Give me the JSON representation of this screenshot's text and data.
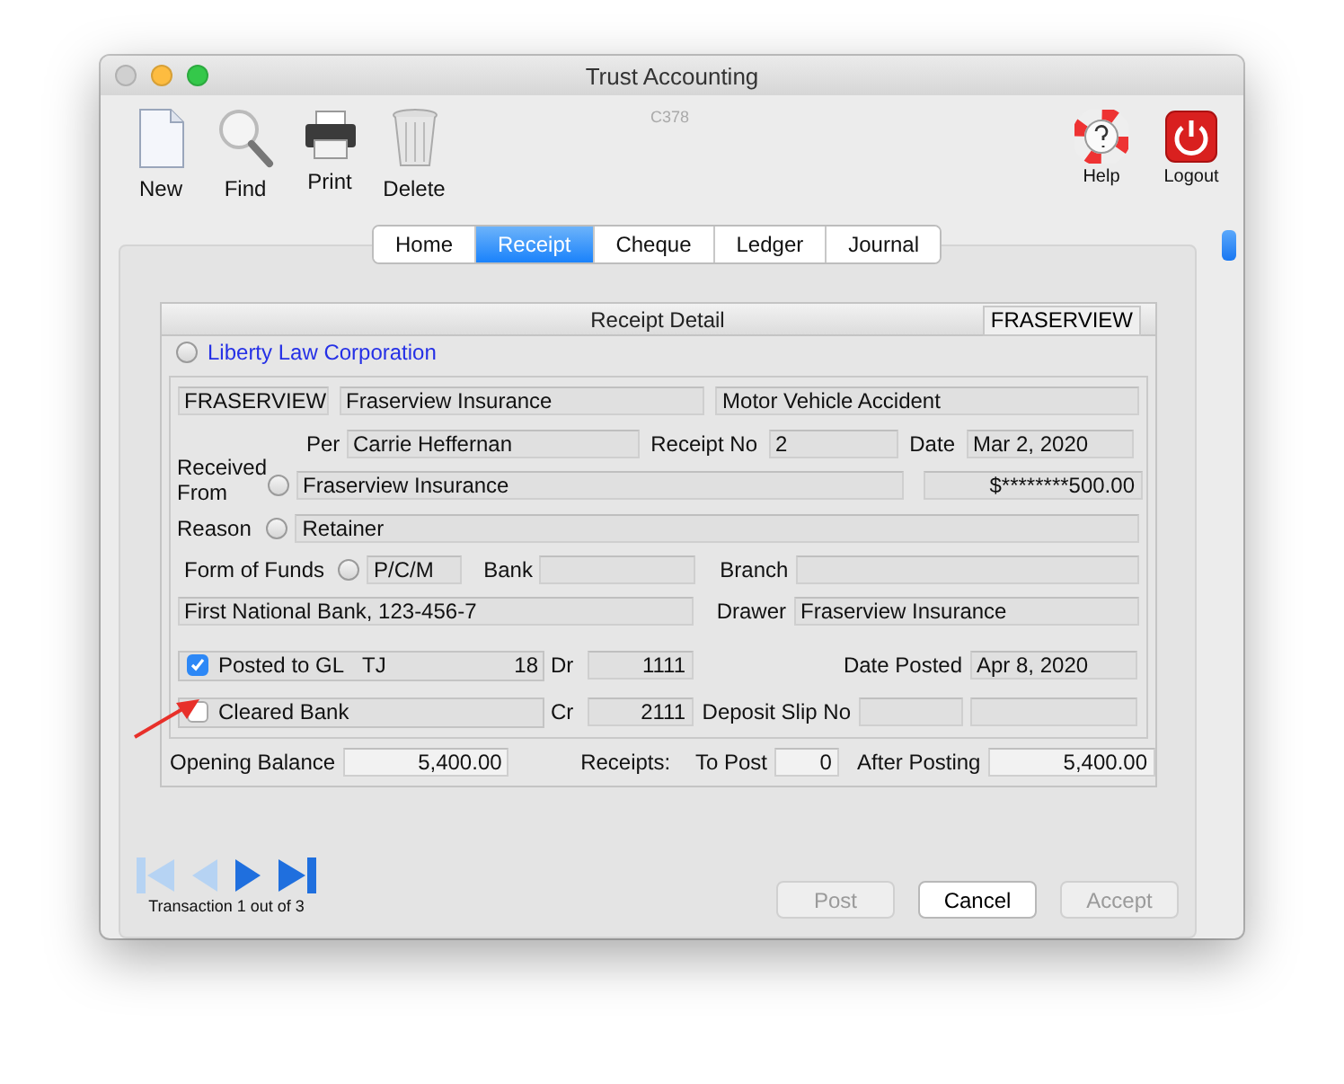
{
  "window": {
    "title": "Trust Accounting",
    "code": "C378"
  },
  "toolbar": [
    {
      "kind": "new",
      "label": "New"
    },
    {
      "kind": "find",
      "label": "Find"
    },
    {
      "kind": "print",
      "label": "Print"
    },
    {
      "kind": "delete",
      "label": "Delete"
    }
  ],
  "toolbar_right": [
    {
      "kind": "help",
      "label": "Help"
    },
    {
      "kind": "logout",
      "label": "Logout"
    }
  ],
  "tabs": [
    {
      "label": "Home",
      "selected": false
    },
    {
      "label": "Receipt",
      "selected": true
    },
    {
      "label": "Cheque",
      "selected": false
    },
    {
      "label": "Ledger",
      "selected": false
    },
    {
      "label": "Journal",
      "selected": false
    }
  ],
  "receipt": {
    "title": "Receipt Detail",
    "badge": "FRASERVIEW",
    "firm": {
      "label": "Liberty Law Corporation",
      "selected": false
    },
    "client_code": "FRASERVIEW",
    "client_name": "Fraserview Insurance",
    "matter": "Motor Vehicle Accident",
    "received_from_label": "Received From",
    "per": {
      "label": "Per",
      "value": "Carrie Heffernan"
    },
    "receipt_no": {
      "label": "Receipt No",
      "value": "2"
    },
    "date": {
      "label": "Date",
      "value": "Mar 2, 2020"
    },
    "payer": {
      "value": "Fraserview Insurance",
      "selected": false
    },
    "amount": "$********500.00",
    "reason": {
      "label": "Reason",
      "value": "Retainer",
      "selected": false
    },
    "form_of_funds": {
      "label": "Form of Funds",
      "value": "P/C/M",
      "selected": false
    },
    "bank": {
      "label": "Bank"
    },
    "branch": {
      "label": "Branch"
    },
    "bank_account": "First National Bank, 123-456-7",
    "drawer": {
      "label": "Drawer",
      "value": "Fraserview Insurance"
    },
    "posted_to_gl": {
      "label": "Posted to GL",
      "checked": true,
      "journal": "TJ",
      "number": "18"
    },
    "dr": {
      "label": "Dr",
      "value": "1111"
    },
    "date_posted": {
      "label": "Date Posted",
      "value": "Apr 8, 2020"
    },
    "cleared_bank": {
      "label": "Cleared Bank",
      "checked": false
    },
    "cr": {
      "label": "Cr",
      "value": "2111"
    },
    "deposit_slip_no": {
      "label": "Deposit Slip No"
    },
    "opening_balance": {
      "label": "Opening Balance",
      "value": "5,400.00"
    },
    "receipts_label": "Receipts:",
    "to_post": {
      "label": "To Post",
      "value": "0"
    },
    "after_posting": {
      "label": "After Posting",
      "value": "5,400.00"
    }
  },
  "navigation": {
    "buttons": [
      {
        "kind": "first",
        "disabled": true
      },
      {
        "kind": "prev",
        "disabled": true
      },
      {
        "kind": "next",
        "disabled": false
      },
      {
        "kind": "last",
        "disabled": false
      }
    ],
    "status": "Transaction 1 out of 3"
  },
  "actions": [
    {
      "label": "Post",
      "disabled": true
    },
    {
      "label": "Cancel",
      "disabled": false
    },
    {
      "label": "Accept",
      "disabled": true
    }
  ]
}
